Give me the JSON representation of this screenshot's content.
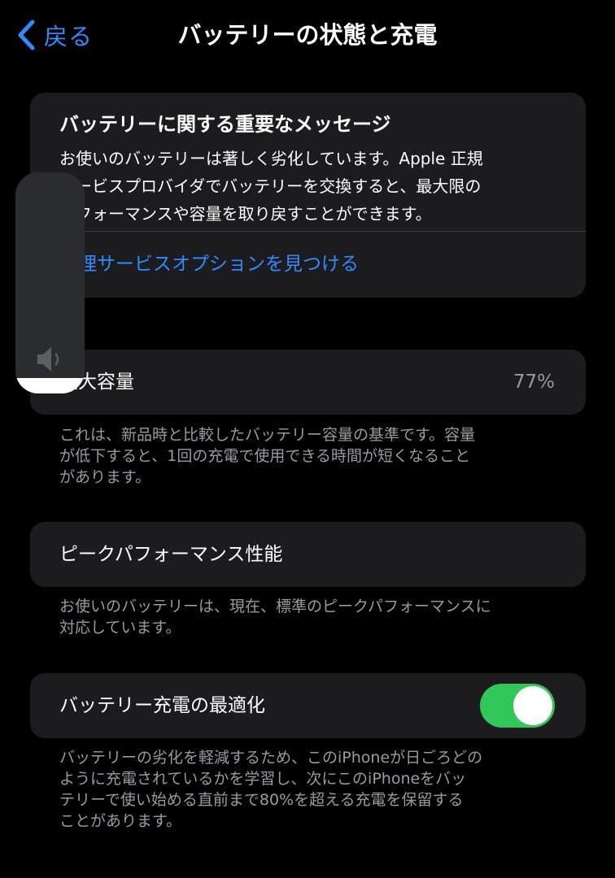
{
  "nav": {
    "back_label": "戻る",
    "title": "バッテリーの状態と充電",
    "back_icon": "chevron-left-icon"
  },
  "message_card": {
    "title": "バッテリーに関する重要なメッセージ",
    "body_lines": [
      "お使いのバッテリーは著しく劣化しています。Apple 正規",
      "サービスプロバイダでバッテリーを交換すると、最大限の",
      "パフォーマンスや容量を取り戻すことができます。"
    ],
    "link": "修理サービスオプションを見つける"
  },
  "capacity": {
    "label": "最大容量",
    "value": "77%",
    "note_lines": [
      "これは、新品時と比較したバッテリー容量の基準です。容量",
      "が低下すると、1回の充電で使用できる時間が短くなること",
      "があります。"
    ]
  },
  "peak": {
    "label": "ピークパフォーマンス性能",
    "note_lines": [
      "お使いのバッテリーは、現在、標準のピークパフォーマンスに",
      "対応しています。"
    ]
  },
  "optimized": {
    "label": "バッテリー充電の最適化",
    "toggle_on": true,
    "note_lines": [
      "バッテリーの劣化を軽減するため、このiPhoneが日ごろどの",
      "ように充電されているかを学習し、次にこのiPhoneをバッ",
      "テリーで使い始める直前まで80%を超える充電を保留する",
      "ことがあります。"
    ]
  },
  "volume_hud": {
    "level": 0.07,
    "icon": "speaker-icon"
  },
  "colors": {
    "background": "#000000",
    "card": "#1c1c1e",
    "accent_blue": "#2f8cff",
    "toggle_green": "#32c759",
    "secondary_text": "#9a9aa1"
  }
}
